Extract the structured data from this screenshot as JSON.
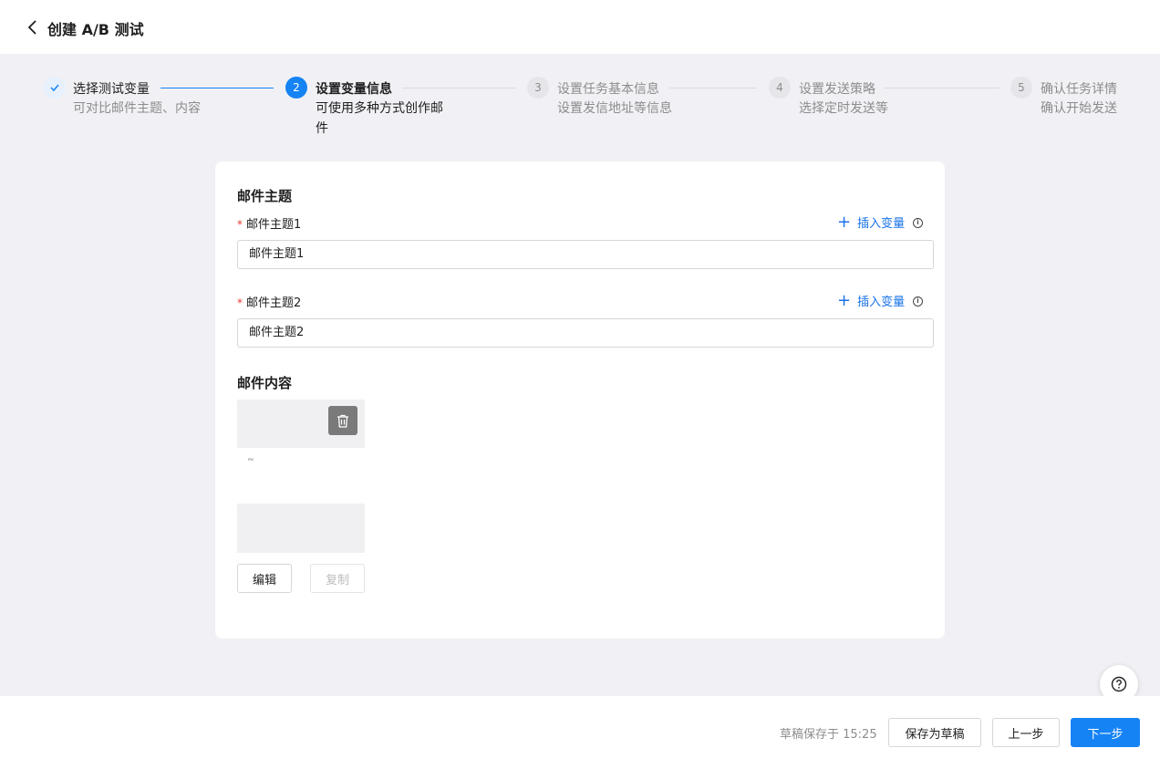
{
  "header": {
    "title": "创建 A/B 测试"
  },
  "steps": [
    {
      "number": "",
      "title": "选择测试变量",
      "desc": "可对比邮件主题、内容",
      "status": "done"
    },
    {
      "number": "2",
      "title": "设置变量信息",
      "desc": "可使用多种方式创作邮件",
      "status": "active"
    },
    {
      "number": "3",
      "title": "设置任务基本信息",
      "desc": "设置发信地址等信息",
      "status": "pending"
    },
    {
      "number": "4",
      "title": "设置发送策略",
      "desc": "选择定时发送等",
      "status": "pending"
    },
    {
      "number": "5",
      "title": "确认任务详情",
      "desc": "确认开始发送",
      "status": "pending"
    }
  ],
  "form": {
    "subject_section_title": "邮件主题",
    "required_mark": "*",
    "subject1": {
      "label": "邮件主题1",
      "value": "邮件主题1"
    },
    "subject2": {
      "label": "邮件主题2",
      "value": "邮件主题2"
    },
    "insert_variable_label": "插入变量",
    "info_glyph": "i",
    "content_section_title": "邮件内容",
    "preview_text": "ms",
    "edit_label": "编辑",
    "copy_label": "复制"
  },
  "footer": {
    "save_status": "草稿保存于 15:25",
    "save_draft_label": "保存为草稿",
    "prev_label": "上一步",
    "next_label": "下一步"
  },
  "colors": {
    "primary": "#1683f5",
    "link": "#1a73e8",
    "required": "#e53935",
    "page_bg": "#f1f1f5"
  }
}
